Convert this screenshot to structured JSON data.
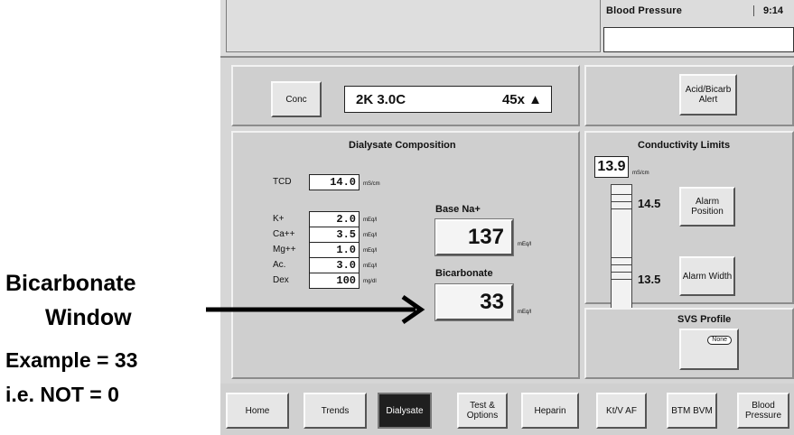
{
  "annotation": {
    "line1": "Bicarbonate",
    "line2": "Window",
    "line3": "Example = 33",
    "line4": "i.e. NOT = 0"
  },
  "header": {
    "blood_pressure_title": "Blood Pressure",
    "time": "9:14"
  },
  "concentrate": {
    "button_label": "Conc",
    "value": "2K 3.0C",
    "ratio": "45x",
    "ratio_symbol": "▲"
  },
  "acid_bicarb_alert": "Acid/Bicarb Alert",
  "dialysate": {
    "title": "Dialysate  Composition",
    "tcd": {
      "label": "TCD",
      "value": "14.0",
      "unit": "mS/cm"
    },
    "electrolytes": [
      {
        "label": "K+",
        "value": "2.0",
        "unit": "mEq/l"
      },
      {
        "label": "Ca++",
        "value": "3.5",
        "unit": "mEq/l"
      },
      {
        "label": "Mg++",
        "value": "1.0",
        "unit": "mEq/l"
      },
      {
        "label": "Ac.",
        "value": "3.0",
        "unit": "mEq/l"
      },
      {
        "label": "Dex",
        "value": "100",
        "unit": "mg/dl"
      }
    ],
    "base_na": {
      "label": "Base  Na+",
      "value": "137",
      "unit": "mEq/l"
    },
    "bicarbonate": {
      "label": "Bicarbonate",
      "value": "33",
      "unit": "mEq/l"
    }
  },
  "conductivity": {
    "title": "Conductivity  Limits",
    "current": "13.9",
    "unit": "mS/cm",
    "upper": "14.5",
    "lower": "13.5",
    "alarm_position": "Alarm Position",
    "alarm_width": "Alarm Width"
  },
  "svs": {
    "title": "SVS  Profile",
    "button_label": "None"
  },
  "tabs": [
    {
      "label": "Home"
    },
    {
      "label": "Trends"
    },
    {
      "label": "Dialysate"
    },
    {
      "label": "Test & Options"
    },
    {
      "label": "Heparin"
    },
    {
      "label": "Kt/V AF"
    },
    {
      "label": "BTM BVM"
    },
    {
      "label": "Blood Pressure"
    }
  ]
}
